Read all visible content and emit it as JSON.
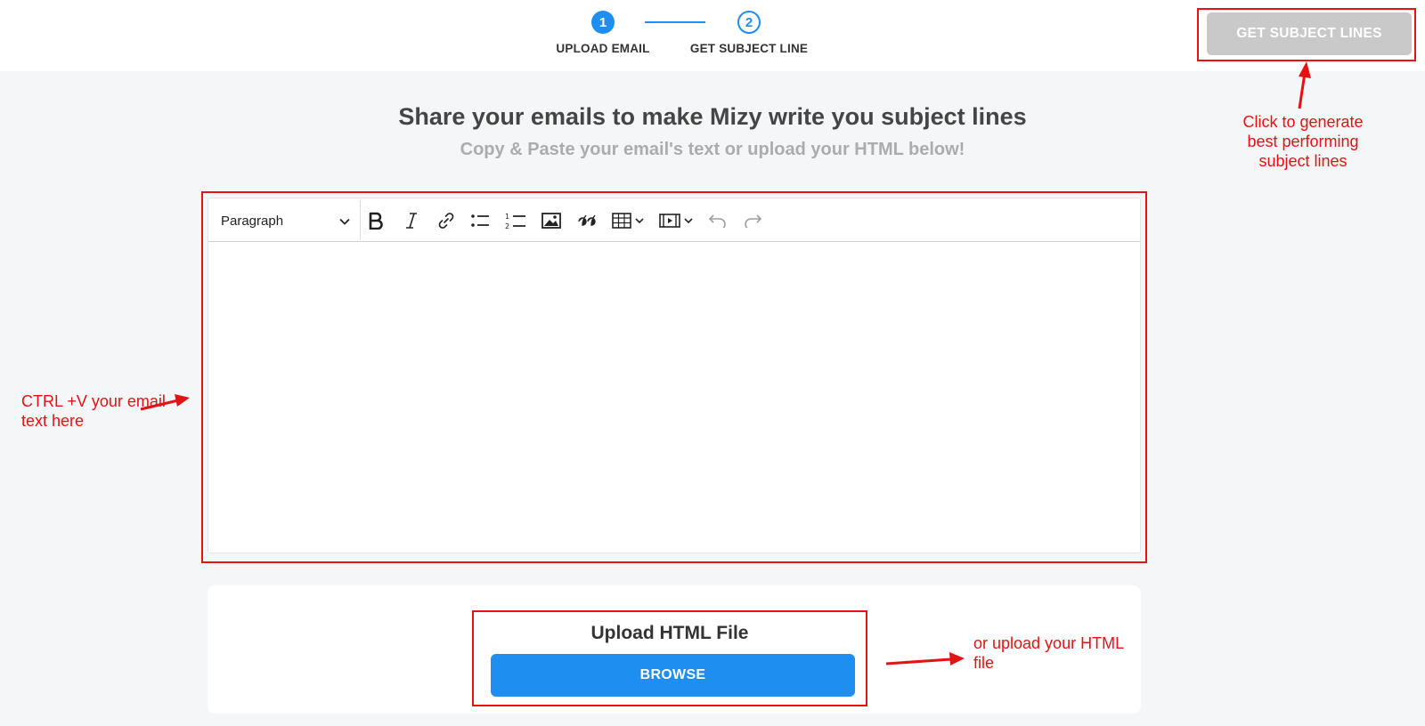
{
  "stepper": {
    "steps": [
      {
        "number": "1",
        "label": "UPLOAD EMAIL"
      },
      {
        "number": "2",
        "label": "GET SUBJECT LINE"
      }
    ]
  },
  "header": {
    "cta_label": "GET SUBJECT LINES"
  },
  "main": {
    "title": "Share your emails to make Mizy write you subject lines",
    "subtitle": "Copy & Paste your email's text or upload your HTML below!"
  },
  "editor": {
    "format_value": "Paragraph",
    "content": "",
    "tools": [
      "bold-icon",
      "italic-icon",
      "link-icon",
      "bulleted-list-icon",
      "numbered-list-icon",
      "image-icon",
      "blockquote-icon",
      "table-icon",
      "media-icon",
      "undo-icon",
      "redo-icon"
    ]
  },
  "upload": {
    "title": "Upload HTML File",
    "browse_label": "BROWSE"
  },
  "annotations": {
    "cta_note": "Click to generate best performing subject lines",
    "paste_note": "CTRL +V your email text here",
    "upload_note": "or upload your HTML file"
  },
  "colors": {
    "primary": "#1e8ef0",
    "annotation": "#e41313",
    "disabled_button": "#c9c9c9",
    "background": "#f5f6f8"
  }
}
